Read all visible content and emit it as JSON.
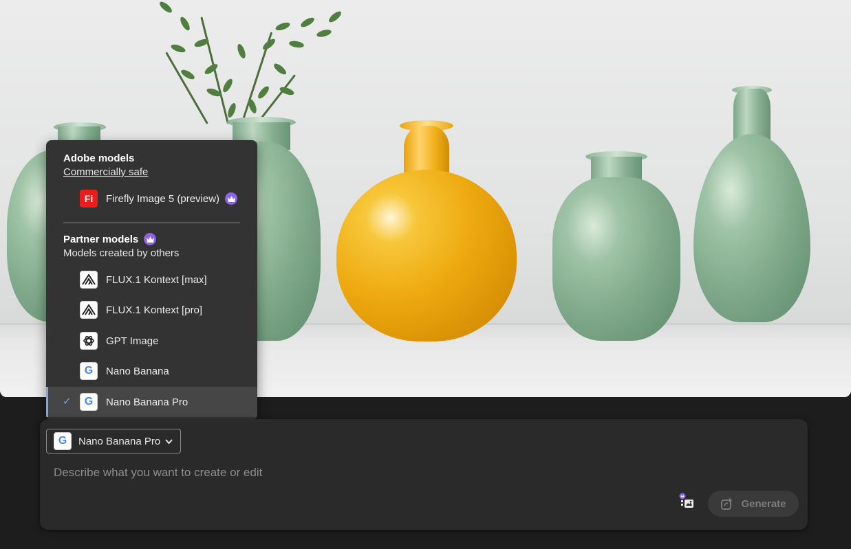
{
  "menu": {
    "adobe_heading": "Adobe models",
    "adobe_sub": "Commercially safe",
    "adobe_items": [
      {
        "label": "Firefly Image 5 (preview)",
        "icon": "firefly-fi-icon",
        "icon_text": "Fi",
        "premium": true
      }
    ],
    "partner_heading": "Partner models",
    "partner_sub": "Models created by others",
    "partner_items": [
      {
        "label": "FLUX.1 Kontext [max]",
        "icon": "flux-icon"
      },
      {
        "label": "FLUX.1 Kontext [pro]",
        "icon": "flux-icon"
      },
      {
        "label": "GPT Image",
        "icon": "openai-icon"
      },
      {
        "label": "Nano Banana",
        "icon": "google-g-icon",
        "icon_text": "G"
      },
      {
        "label": "Nano Banana Pro",
        "icon": "google-g-icon",
        "icon_text": "G",
        "selected": true
      }
    ],
    "check_glyph": "✓"
  },
  "prompt": {
    "selected_model": "Nano Banana Pro",
    "selected_model_icon_text": "G",
    "placeholder": "Describe what you want to create or edit",
    "value": "",
    "generate_label": "Generate"
  },
  "colors": {
    "menu_bg": "#333333",
    "selected_accent": "#7aa7e6",
    "premium_crown": "#8a63e6",
    "firefly_red": "#e91d1d",
    "google_blue": "#4285f4"
  }
}
